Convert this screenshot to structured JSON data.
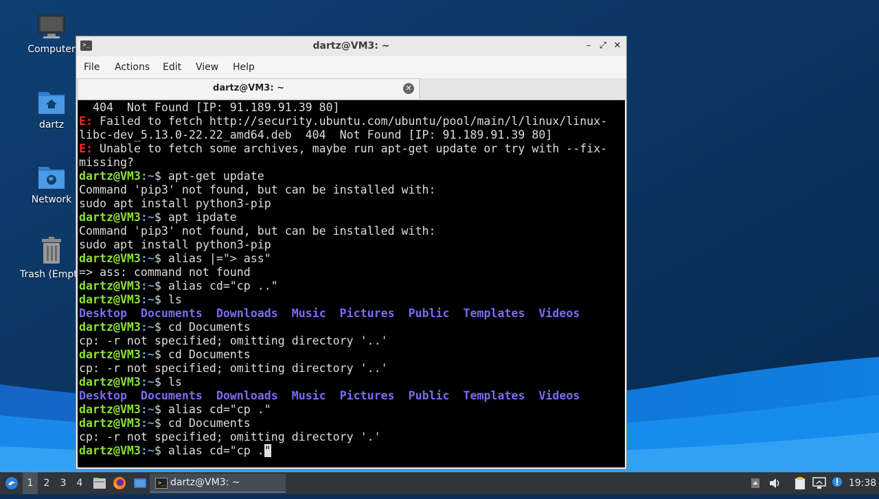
{
  "desktop": {
    "icons": [
      {
        "label": "Computer"
      },
      {
        "label": "dartz"
      },
      {
        "label": "Network"
      },
      {
        "label": "Trash (Empty)"
      }
    ]
  },
  "window": {
    "title": "dartz@VM3: ~",
    "controls": {
      "minimize": "–",
      "maximize": "⤢",
      "close": "✕"
    },
    "menu": [
      "File",
      "Actions",
      "Edit",
      "View",
      "Help"
    ],
    "tab": {
      "title": "dartz@VM3: ~"
    }
  },
  "terminal": {
    "prompt_user": "dartz@VM3",
    "prompt_path": ":~",
    "prompt_sym": "$",
    "lines": [
      {
        "text": "  404  Not Found [IP: 91.189.91.39 80]"
      },
      {
        "err": "E:",
        "text": " Failed to fetch http://security.ubuntu.com/ubuntu/pool/main/l/linux/linux-"
      },
      {
        "text": "libc-dev_5.13.0-22.22_amd64.deb  404  Not Found [IP: 91.189.91.39 80]"
      },
      {
        "err": "E:",
        "text": " Unable to fetch some archives, maybe run apt-get update or try with --fix-"
      },
      {
        "text": "missing?"
      },
      {
        "prompt": true,
        "cmd": " apt-get update"
      },
      {
        "text": "Command 'pip3' not found, but can be installed with:"
      },
      {
        "text": "sudo apt install python3-pip"
      },
      {
        "prompt": true,
        "cmd": " apt ipdate"
      },
      {
        "text": "Command 'pip3' not found, but can be installed with:"
      },
      {
        "text": "sudo apt install python3-pip"
      },
      {
        "prompt": true,
        "cmd": " alias |=\"> ass\""
      },
      {
        "text": "=> ass: command not found"
      },
      {
        "prompt": true,
        "cmd": " alias cd=\"cp ..\""
      },
      {
        "prompt": true,
        "cmd": " ls"
      },
      {
        "dirs": [
          "Desktop",
          "Documents",
          "Downloads",
          "Music",
          "Pictures",
          "Public",
          "Templates",
          "Videos"
        ]
      },
      {
        "prompt": true,
        "cmd": " cd Documents"
      },
      {
        "text": "cp: -r not specified; omitting directory '..'"
      },
      {
        "prompt": true,
        "cmd": " cd Documents"
      },
      {
        "text": "cp: -r not specified; omitting directory '..'"
      },
      {
        "prompt": true,
        "cmd": " ls"
      },
      {
        "dirs": [
          "Desktop",
          "Documents",
          "Downloads",
          "Music",
          "Pictures",
          "Public",
          "Templates",
          "Videos"
        ]
      },
      {
        "prompt": true,
        "cmd": " alias cd=\"cp .\""
      },
      {
        "prompt": true,
        "cmd": " cd Documents"
      },
      {
        "text": "cp: -r not specified; omitting directory '.'"
      },
      {
        "prompt": true,
        "cmd": " alias cd=\"cp .",
        "cursor": "\""
      }
    ]
  },
  "taskbar": {
    "workspaces": [
      "1",
      "2",
      "3",
      "4"
    ],
    "task_label": "dartz@VM3: ~",
    "clock": "19:38"
  },
  "colors": {
    "prompt_user": "#8ae234",
    "prompt_path": "#729fcf",
    "error": "#ef2929",
    "directory": "#7a6cf2",
    "taskbar_bg": "#2f353b"
  }
}
